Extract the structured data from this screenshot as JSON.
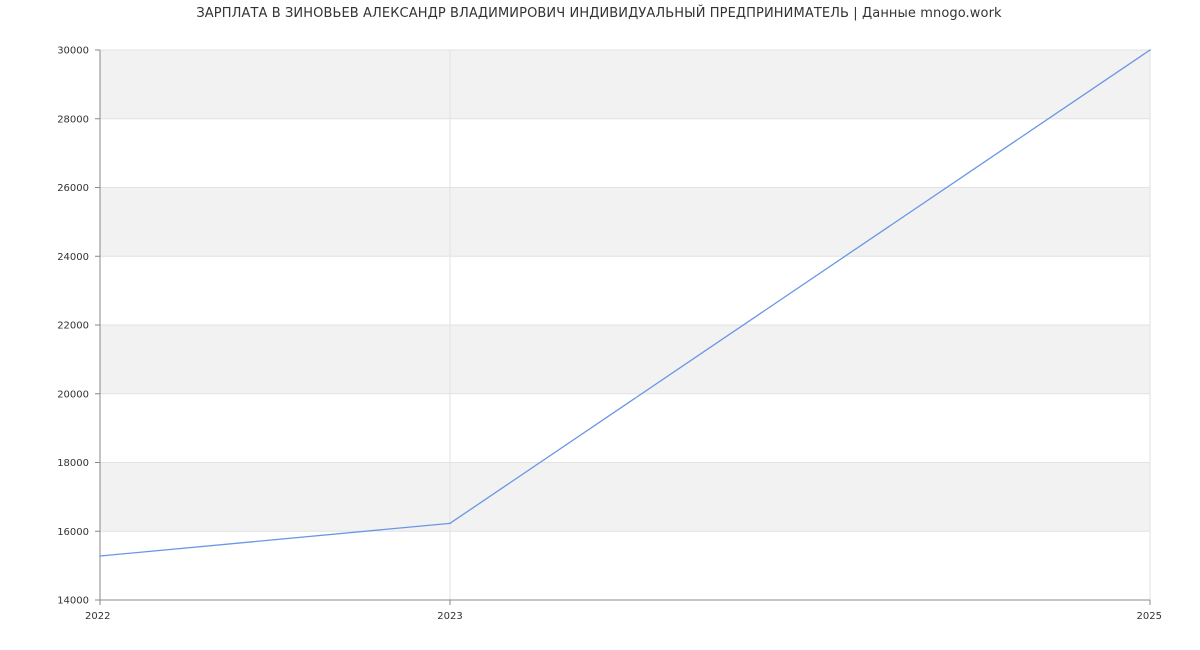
{
  "chart_data": {
    "type": "line",
    "title": "ЗАРПЛАТА В ЗИНОВЬЕВ АЛЕКСАНДР ВЛАДИМИРОВИЧ ИНДИВИДУАЛЬНЫЙ ПРЕДПРИНИМАТЕЛЬ | Данные mnogo.work",
    "xlabel": "",
    "ylabel": "",
    "x": [
      2022,
      2023,
      2025
    ],
    "x_tick_labels": [
      "2022",
      "2023",
      "2025"
    ],
    "series": [
      {
        "values": [
          15280,
          16230,
          30000
        ]
      }
    ],
    "ylim": [
      14000,
      30000
    ],
    "y_ticks": [
      14000,
      16000,
      18000,
      20000,
      22000,
      24000,
      26000,
      28000,
      30000
    ],
    "y_tick_labels": [
      "14000",
      "16000",
      "18000",
      "20000",
      "22000",
      "24000",
      "26000",
      "28000",
      "30000"
    ],
    "grid": true,
    "band_shading": true,
    "colors": {
      "line": "#6a96e6",
      "band": "#f2f2f2",
      "grid": "#e2e2e2",
      "axis": "#888888",
      "text": "#333333"
    }
  }
}
